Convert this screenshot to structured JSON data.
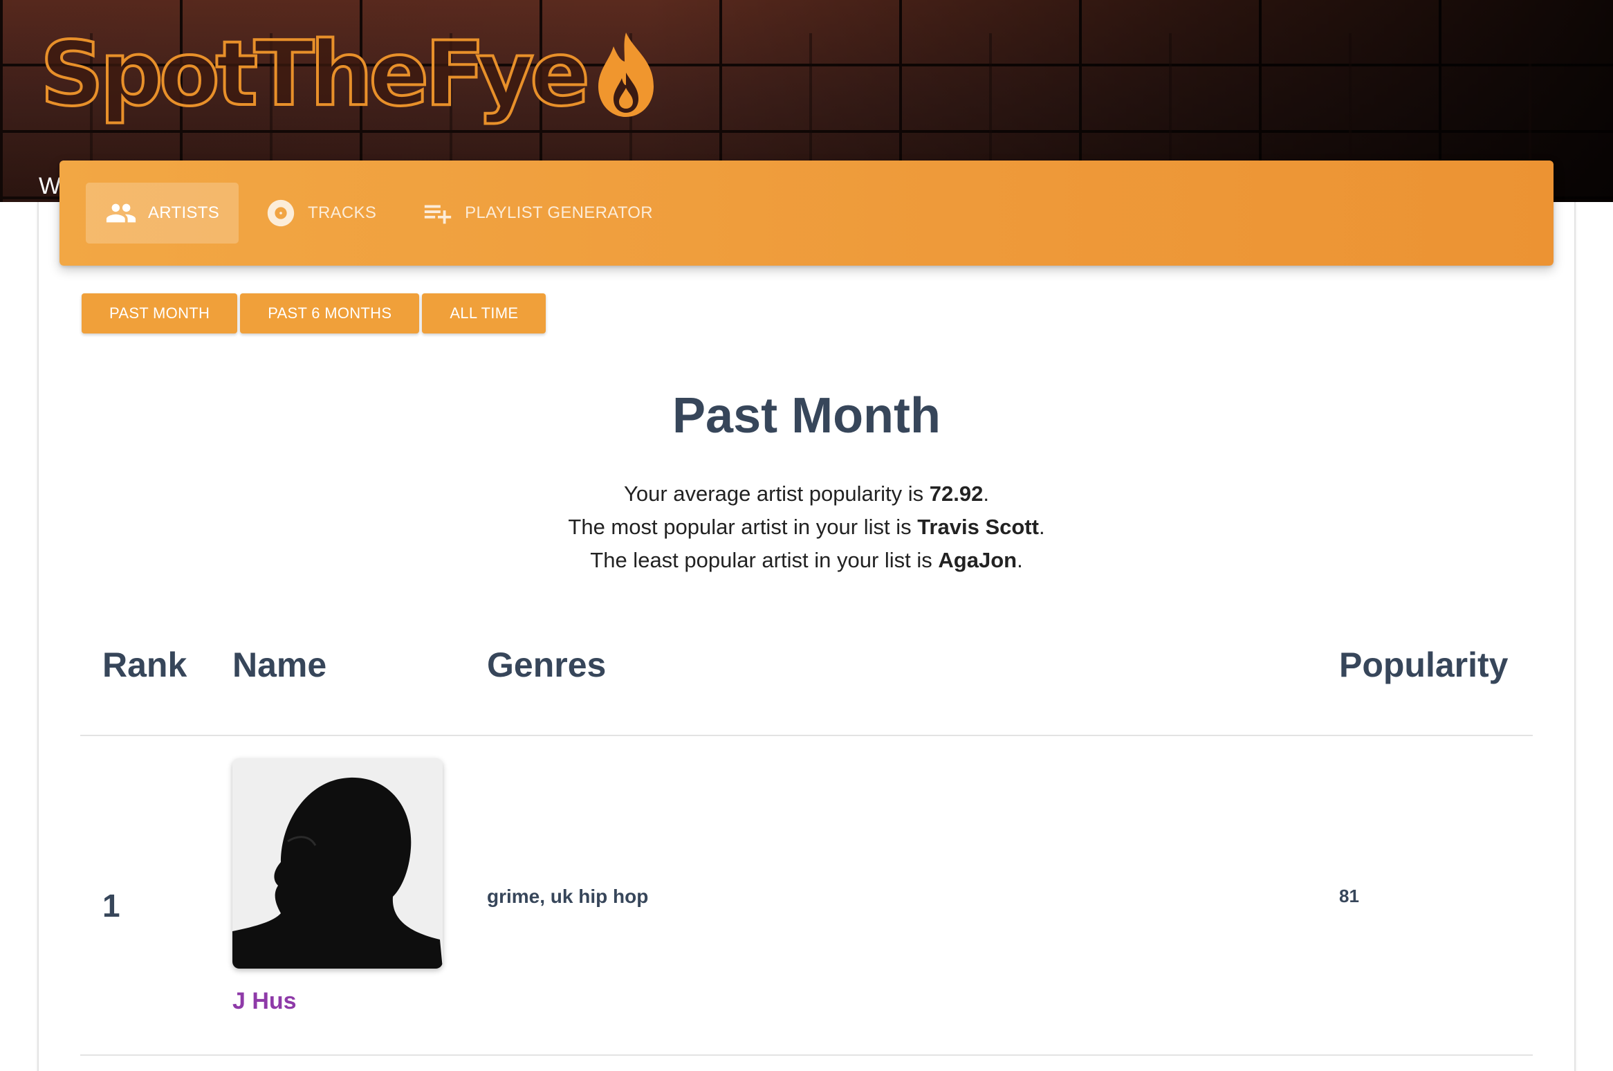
{
  "brand": {
    "name": "SpotTheFye",
    "logo_icon": "flame-icon",
    "accent": "#f0a03a",
    "banner_partial_text": "W"
  },
  "nav": {
    "tabs": [
      {
        "label": "ARTISTS",
        "icon": "people-icon",
        "active": true
      },
      {
        "label": "TRACKS",
        "icon": "disc-icon",
        "active": false
      },
      {
        "label": "PLAYLIST GENERATOR",
        "icon": "playlist-add-icon",
        "active": false
      }
    ]
  },
  "periods": [
    "PAST MONTH",
    "PAST 6 MONTHS",
    "ALL TIME"
  ],
  "page_title": "Past Month",
  "summary": {
    "avg_prefix": "Your average artist popularity is ",
    "avg_value": "72.92",
    "most_prefix": "The most popular artist in your list is ",
    "most_value": "Travis Scott",
    "least_prefix": "The least popular artist in your list is ",
    "least_value": "AgaJon",
    "suffix": "."
  },
  "table": {
    "headers": {
      "rank": "Rank",
      "name": "Name",
      "genres": "Genres",
      "popularity": "Popularity"
    },
    "rows": [
      {
        "rank": "1",
        "name": "J Hus",
        "genres": "grime, uk hip hop",
        "popularity": "81"
      }
    ]
  }
}
